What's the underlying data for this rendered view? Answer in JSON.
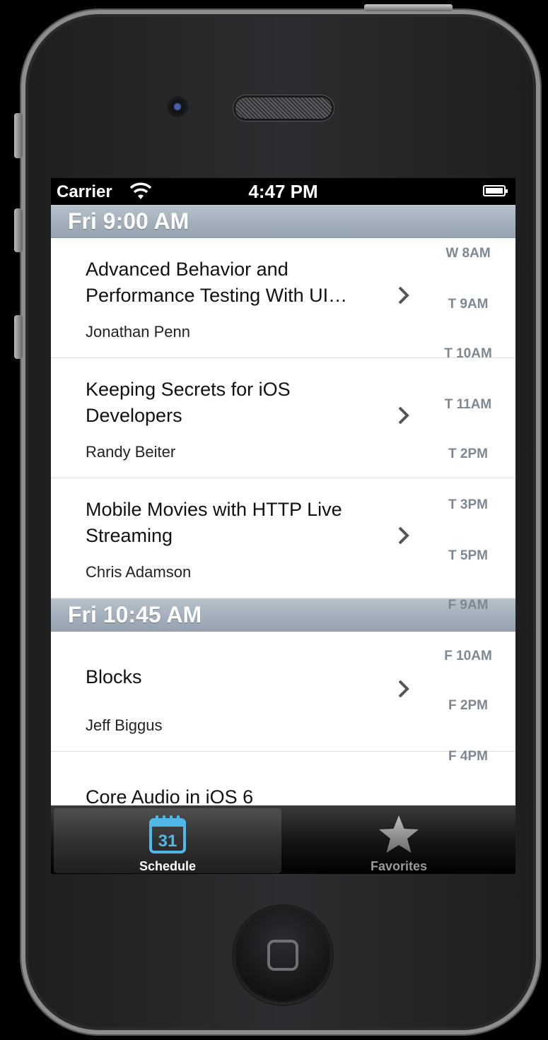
{
  "status_bar": {
    "carrier": "Carrier",
    "time": "4:47 PM"
  },
  "sections": [
    {
      "header": "Fri 9:00 AM",
      "rows": [
        {
          "title": "Advanced Behavior and Performance Testing With UI…",
          "speaker": "Jonathan Penn"
        },
        {
          "title": "Keeping Secrets for iOS Developers",
          "speaker": "Randy Beiter"
        },
        {
          "title": "Mobile Movies with HTTP Live Streaming",
          "speaker": "Chris Adamson"
        }
      ]
    },
    {
      "header": "Fri 10:45 AM",
      "rows": [
        {
          "title": "Blocks",
          "speaker": "Jeff  Biggus"
        },
        {
          "title": "Core Audio in iOS 6",
          "speaker": ""
        }
      ]
    }
  ],
  "section_index": [
    "W 8AM",
    "T 9AM",
    "T 10AM",
    "T 11AM",
    "T 2PM",
    "T 3PM",
    "T 5PM",
    "F 9AM",
    "F 10AM",
    "F 2PM",
    "F 4PM"
  ],
  "tabs": [
    {
      "label": "Schedule",
      "icon": "calendar-icon",
      "icon_text": "31",
      "selected": true
    },
    {
      "label": "Favorites",
      "icon": "star-icon",
      "selected": false
    }
  ],
  "colors": {
    "accent": "#4fb8e8",
    "section_header": "#a1adb9",
    "index_text": "#7e8892"
  }
}
